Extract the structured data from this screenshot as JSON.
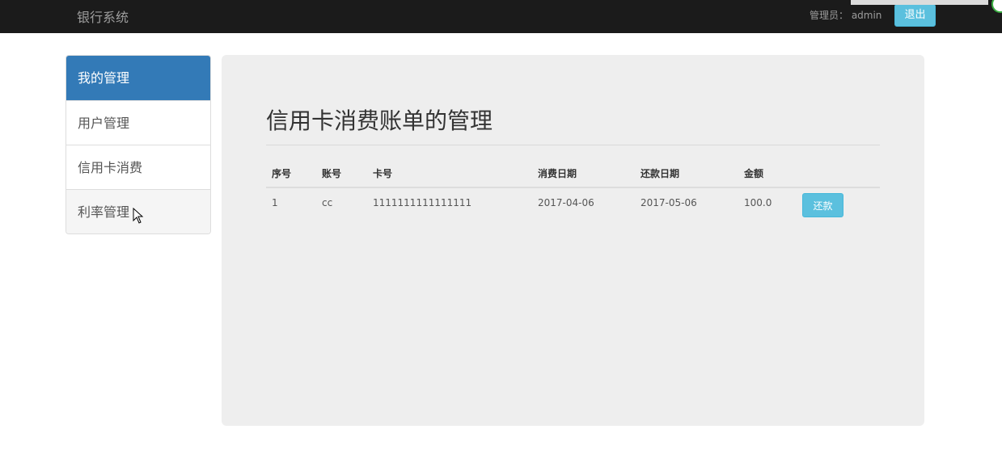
{
  "navbar": {
    "brand": "银行系统",
    "admin_label": "管理员： admin",
    "logout_label": "退出"
  },
  "sidebar": {
    "items": [
      {
        "label": "我的管理"
      },
      {
        "label": "用户管理"
      },
      {
        "label": "信用卡消费"
      },
      {
        "label": "利率管理"
      }
    ]
  },
  "main": {
    "title": "信用卡消费账单的管理",
    "table": {
      "headers": [
        "序号",
        "账号",
        "卡号",
        "消费日期",
        "还款日期",
        "金额"
      ],
      "rows": [
        {
          "index": "1",
          "account": "cc",
          "card": "1111111111111111",
          "spend_date": "2017-04-06",
          "repay_date": "2017-05-06",
          "amount": "100.0",
          "action": "还款"
        }
      ]
    }
  },
  "colors": {
    "navbar_bg": "#1b1b1b",
    "primary": "#337ab7",
    "info": "#5bc0de",
    "panel_bg": "#eeeeee"
  }
}
